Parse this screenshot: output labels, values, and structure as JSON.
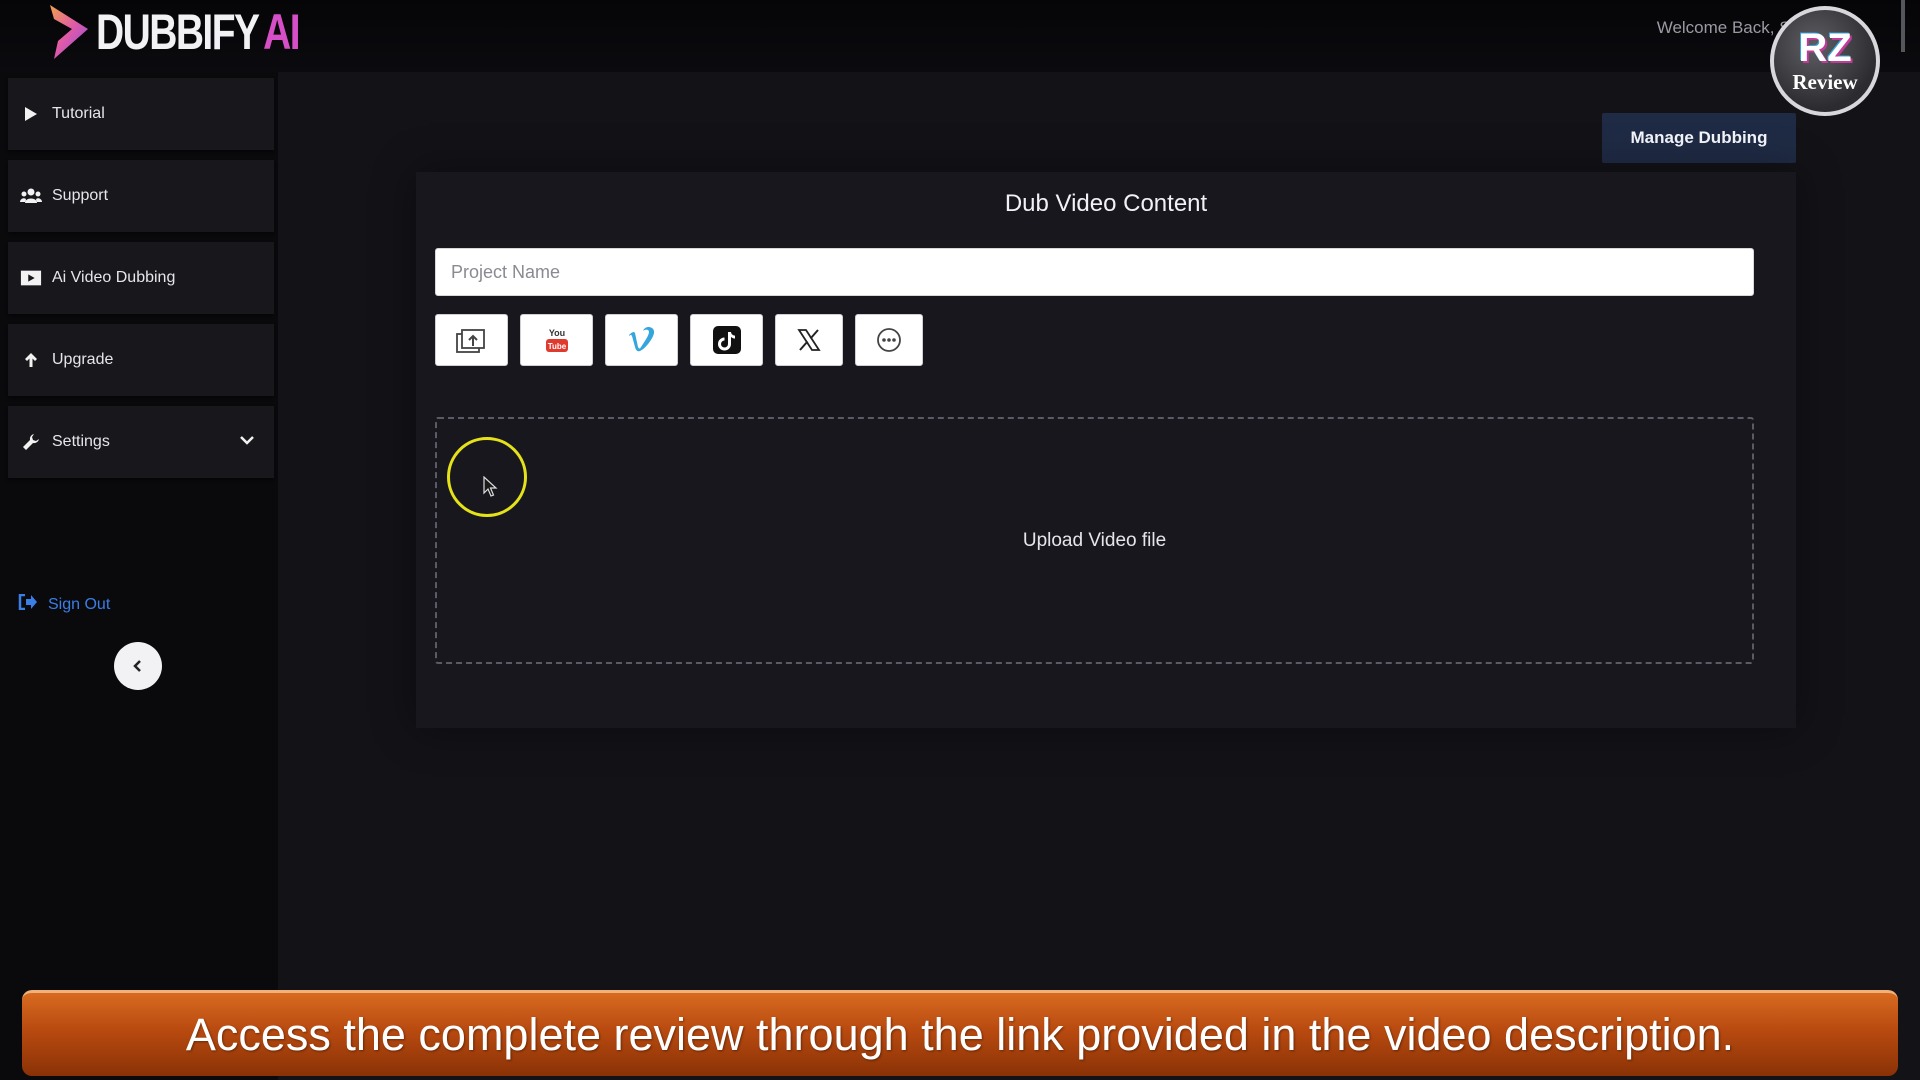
{
  "brand": {
    "name": "DUBBIFY",
    "suffix": "AI"
  },
  "header": {
    "welcome_text": "Welcome Back, Se"
  },
  "watermark": {
    "monogram": "RZ",
    "label": "Review"
  },
  "sidebar": {
    "items": [
      {
        "label": "Tutorial",
        "icon": "play-icon"
      },
      {
        "label": "Support",
        "icon": "users-icon"
      },
      {
        "label": "Ai Video Dubbing",
        "icon": "video-icon"
      },
      {
        "label": "Upgrade",
        "icon": "arrow-up-icon"
      },
      {
        "label": "Settings",
        "icon": "wrench-icon",
        "has_dropdown": true
      }
    ],
    "sign_out": "Sign Out",
    "accent_color": "#3a7ee6"
  },
  "main": {
    "manage_button": "Manage Dubbing",
    "card": {
      "title": "Dub Video Content",
      "project_name_placeholder": "Project Name",
      "project_name_value": "",
      "sources": [
        {
          "name": "upload-file",
          "icon": "upload-icon"
        },
        {
          "name": "youtube",
          "icon": "youtube-icon",
          "text": "You Tube"
        },
        {
          "name": "vimeo",
          "icon": "vimeo-icon",
          "text": "V"
        },
        {
          "name": "tiktok",
          "icon": "tiktok-icon"
        },
        {
          "name": "x",
          "icon": "x-icon"
        },
        {
          "name": "more",
          "icon": "more-icon"
        }
      ],
      "dropzone_label": "Upload Video file"
    }
  },
  "banner": {
    "text": "Access the complete review through the link provided in the video description."
  },
  "colors": {
    "background": "#131318",
    "sidebar": "#0a0a0d",
    "card": "#17171d",
    "manage_button": "#1f2a44",
    "banner": "#c45716",
    "cursor_highlight": "#e6e21a",
    "brand_accent": "#d64fc7"
  }
}
